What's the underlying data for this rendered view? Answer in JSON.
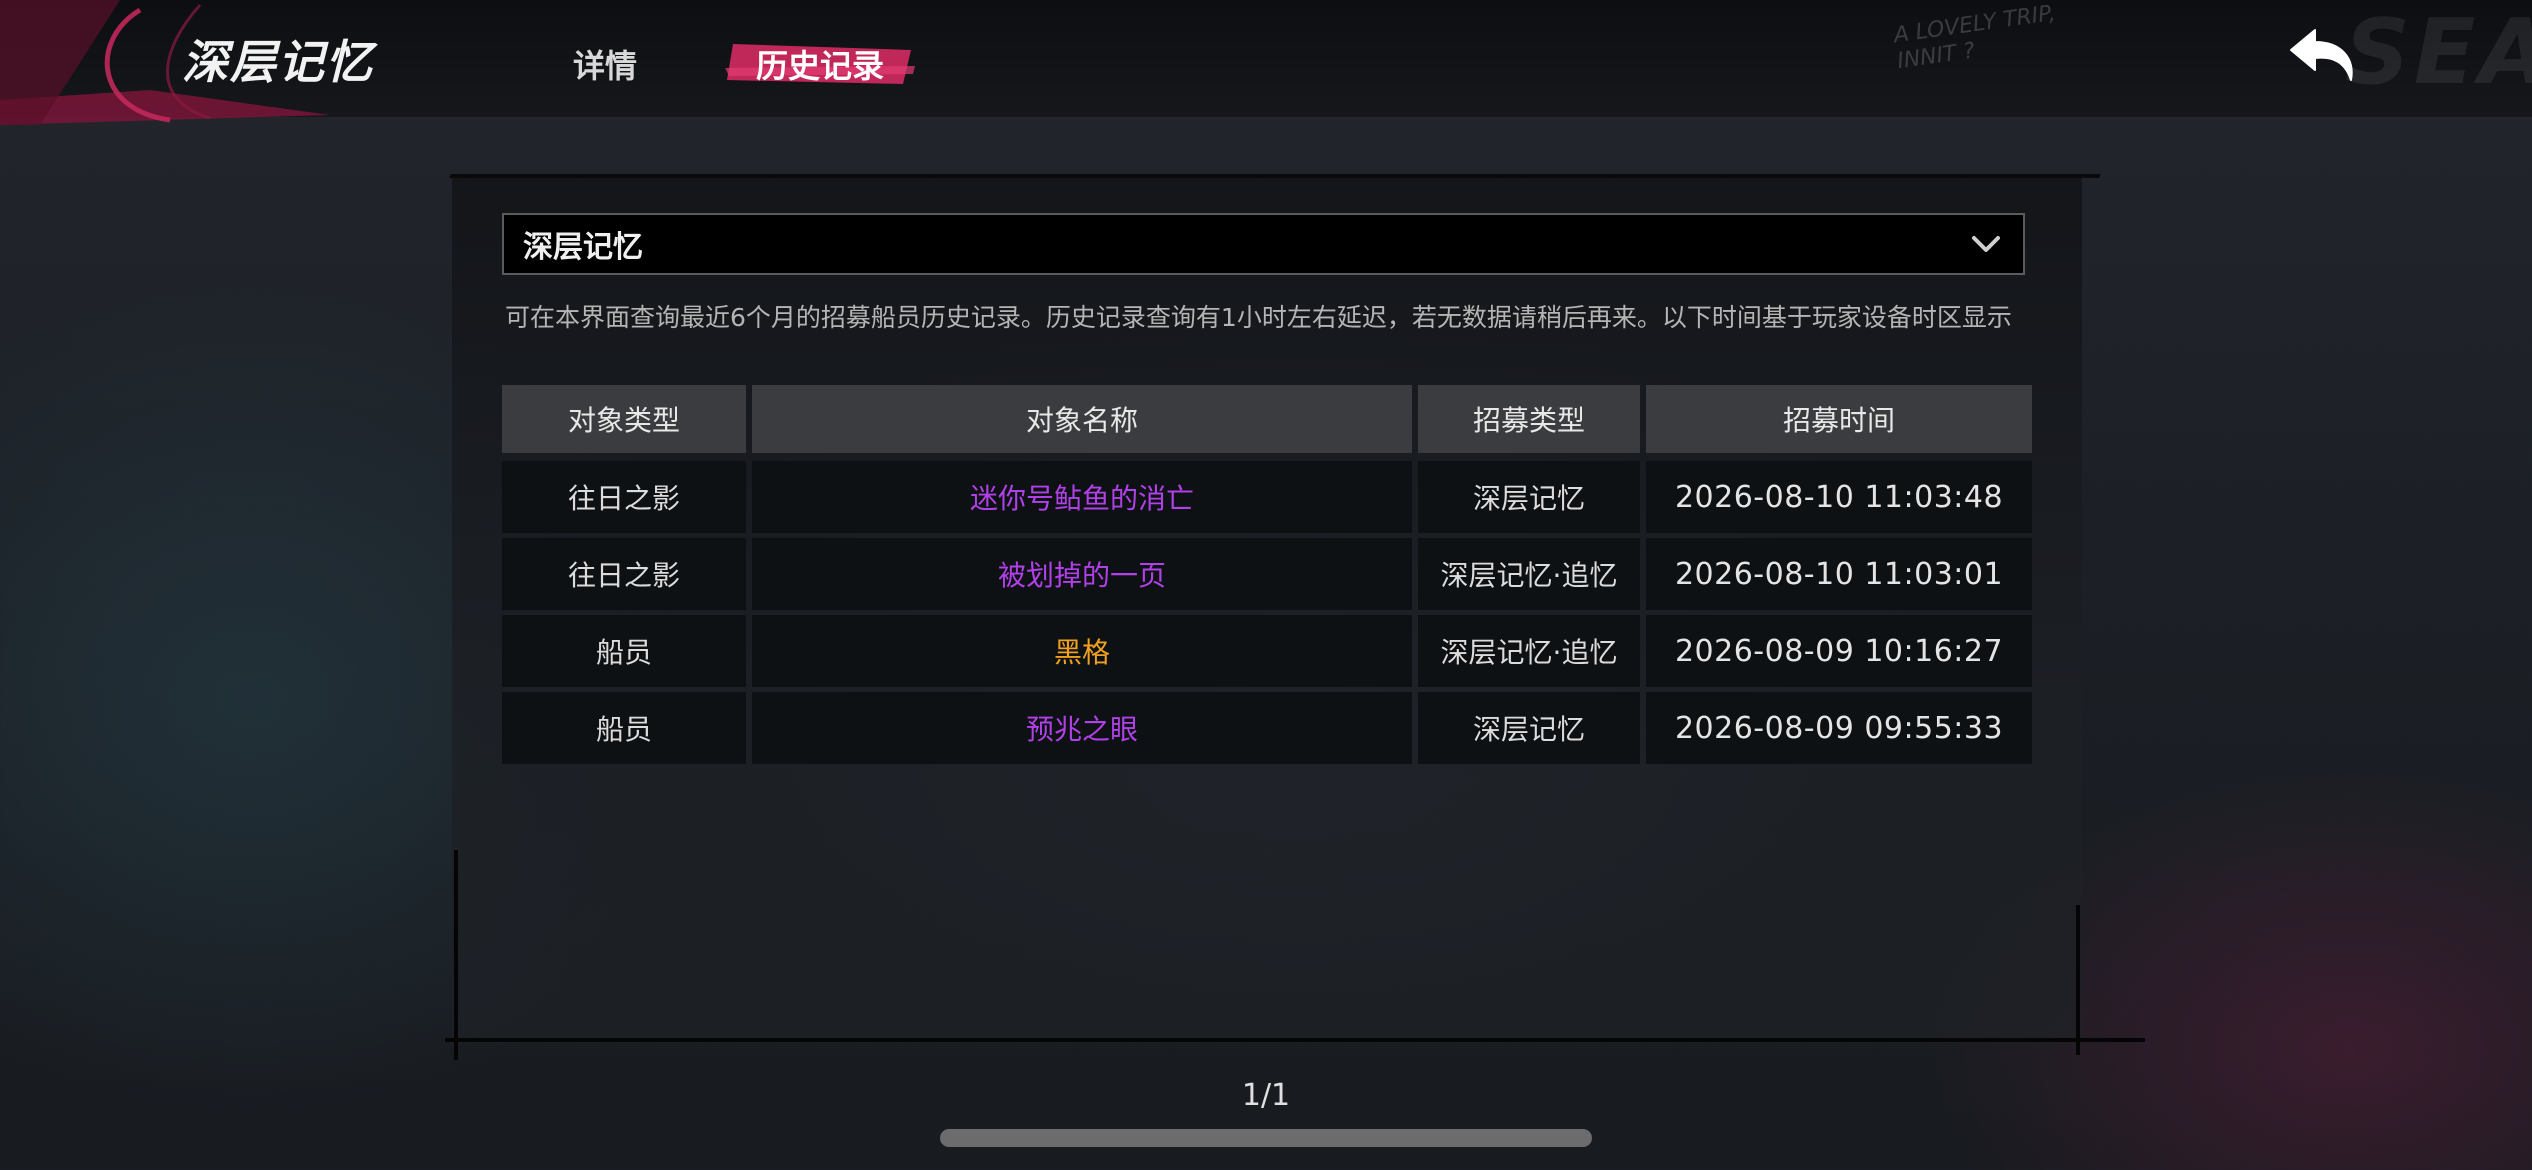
{
  "app": {
    "title": "深层记忆",
    "scrawl_text": "A LOVELY TRIP,\nINNIT ?",
    "corner_mark": "SEA"
  },
  "tabs": [
    {
      "label": "详情",
      "active": false
    },
    {
      "label": "历史记录",
      "active": true
    }
  ],
  "icons": {
    "back": "back-arrow-icon",
    "dropdown": "chevron-down-icon"
  },
  "colors": {
    "accent": "#c0285a",
    "purple": "#b040e8",
    "gold": "#f0a020"
  },
  "pool_select": {
    "value": "深层记忆"
  },
  "notice": "可在本界面查询最近6个月的招募船员历史记录。历史记录查询有1小时左右延迟，若无数据请稍后再来。以下时间基于玩家设备时区显示",
  "table": {
    "headers": [
      "对象类型",
      "对象名称",
      "招募类型",
      "招募时间"
    ],
    "rows": [
      {
        "type": "往日之影",
        "name": "迷你号鲇鱼的消亡",
        "name_color": "#b040e8",
        "recruit": "深层记忆",
        "time": "2026-08-10 11:03:48"
      },
      {
        "type": "往日之影",
        "name": "被划掉的一页",
        "name_color": "#b040e8",
        "recruit": "深层记忆·追忆",
        "time": "2026-08-10 11:03:01"
      },
      {
        "type": "船员",
        "name": "黑格",
        "name_color": "#f0a020",
        "recruit": "深层记忆·追忆",
        "time": "2026-08-09 10:16:27"
      },
      {
        "type": "船员",
        "name": "预兆之眼",
        "name_color": "#b040e8",
        "recruit": "深层记忆",
        "time": "2026-08-09 09:55:33"
      }
    ]
  },
  "pagination": {
    "text": "1/1"
  }
}
